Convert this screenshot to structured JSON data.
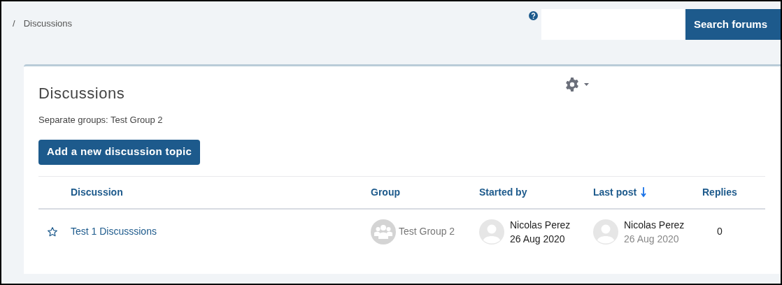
{
  "breadcrumb": {
    "separator": "/",
    "items": [
      "Discussions"
    ]
  },
  "search": {
    "button": "Search forums"
  },
  "title": "Discussions",
  "group_mode": "Separate groups: Test Group 2",
  "add_button": "Add a new discussion topic",
  "table": {
    "columns": [
      {
        "label": "Discussion",
        "sorted": false
      },
      {
        "label": "Group",
        "sorted": false
      },
      {
        "label": "Started by",
        "sorted": false
      },
      {
        "label": "Last post",
        "sorted": true
      },
      {
        "label": "Replies",
        "sorted": false
      }
    ],
    "rows": [
      {
        "starred": false,
        "discussion": "Test 1 Discusssions",
        "group": "Test Group 2",
        "started_by": {
          "name": "Nicolas Perez",
          "date": "26 Aug 2020"
        },
        "last_post": {
          "name": "Nicolas Perez",
          "date": "26 Aug 2020"
        },
        "replies": "0"
      }
    ]
  }
}
